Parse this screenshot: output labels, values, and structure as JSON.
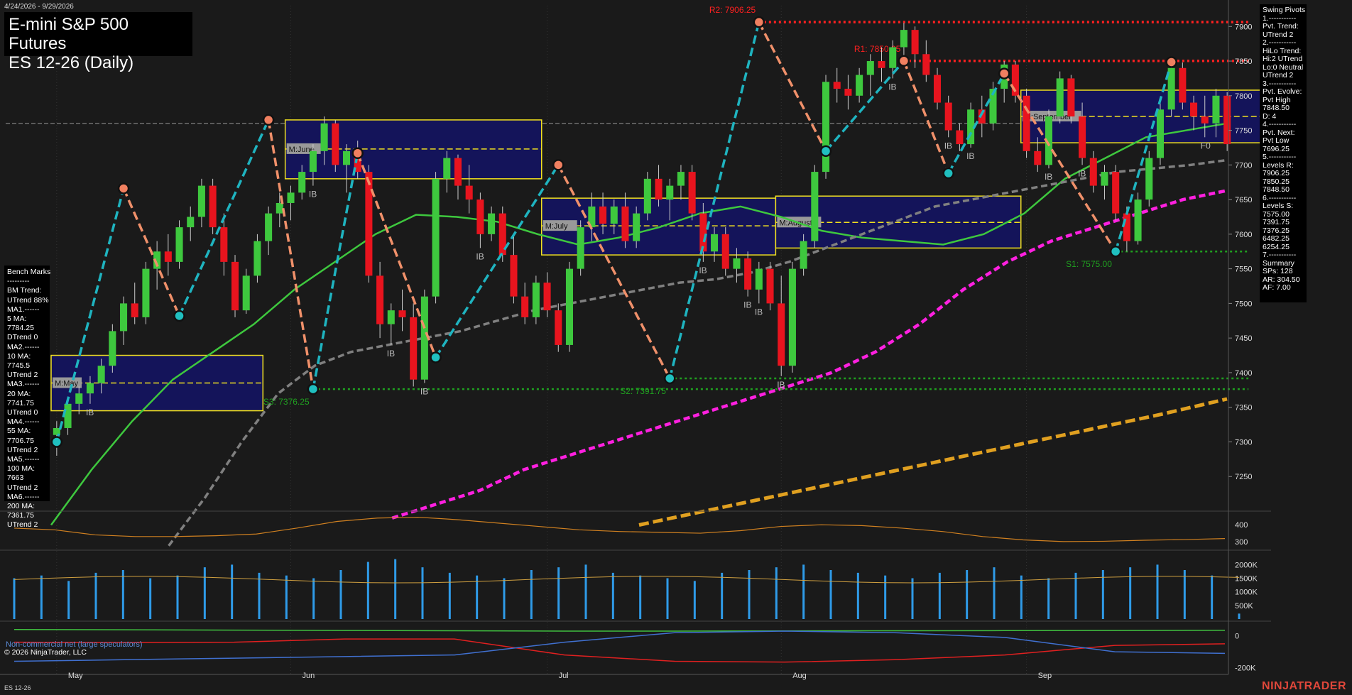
{
  "header": {
    "date_range": "4/24/2026 - 9/29/2026",
    "title": "E-mini S&P 500 Futures",
    "subtitle": "ES 12-26 (Daily)"
  },
  "bench_marks": {
    "lines": [
      "Bench Marks",
      "---------",
      "BM Trend:",
      "UTrend 88%",
      "MA1.------",
      "5 MA:",
      "7784.25",
      "DTrend 0",
      "MA2.------",
      "10 MA:",
      "7745.5",
      "UTrend 2",
      "MA3.------",
      "20 MA:",
      "7741.75",
      "UTrend 0",
      "MA4.------",
      "55 MA:",
      "7706.75",
      "UTrend 2",
      "MA5.------",
      "100 MA:",
      "7663",
      "UTrend 2",
      "MA6.------",
      "200 MA:",
      "7361.75",
      "UTrend 2"
    ]
  },
  "swing_pivots": {
    "lines": [
      "Swing Pivots",
      "1.-----------",
      "Pvt. Trend:",
      "UTrend 2",
      "2.-----------",
      "HiLo Trend:",
      "Hi:2 UTrend",
      "Lo:0 Neutral",
      "UTrend 2",
      "3.-----------",
      "Pvt. Evolve:",
      "Pvt High",
      "7848.50",
      "D: 4",
      "4.-----------",
      "Pvt. Next:",
      "Pvt Low",
      "7696.25",
      "5.-----------",
      "Levels R:",
      "7906.25",
      "7850.25",
      "7848.50",
      "6.-----------",
      "Levels S:",
      "7575.00",
      "7391.75",
      "7376.25",
      "6482.25",
      "6254.25",
      "7.-----------",
      "Summary",
      "SPs: 128",
      "AR: 304.50",
      "AF: 7.00"
    ]
  },
  "footer": {
    "non_commercial": "Non-commercial net (large speculators)",
    "copyright": "© 2026 NinjaTrader, LLC",
    "symbol": "ES 12-26",
    "brand": "NINJATRADER"
  },
  "colors": {
    "background": "#1a1a1a",
    "up_candle": "#3ec83e",
    "down_candle": "#e8141e",
    "zigzag_up": "#1fb4c0",
    "zigzag_down": "#f0906a",
    "ma_green": "#3ec83e",
    "ma_gray": "#808080",
    "ma_magenta": "#ff20e0",
    "ma_gold": "#e0a020",
    "resistance": "#ff2020",
    "support": "#20a020",
    "box_fill": "#14145a",
    "box_border": "#f0e020"
  },
  "chart_data": {
    "type": "candlestick",
    "x_axis": {
      "months": [
        "May",
        "Jun",
        "Jul",
        "Aug",
        "Sep"
      ]
    },
    "price_axis": {
      "ylim": [
        7200,
        7930
      ],
      "ticks": [
        7900,
        7850,
        7800,
        7750,
        7700,
        7650,
        7600,
        7550,
        7500,
        7450,
        7400,
        7350,
        7300,
        7250
      ]
    },
    "panel2_ticks": [
      "400",
      "300"
    ],
    "volume_ticks": [
      "2000K",
      "1500K",
      "1000K",
      "500K"
    ],
    "cot_ticks": [
      "0",
      "-200K"
    ],
    "levels": [
      {
        "label": "R2: 7906.25",
        "value": 7906.25,
        "kind": "resistance"
      },
      {
        "label": "R1: 7850.25",
        "value": 7850.25,
        "kind": "resistance"
      },
      {
        "label": "S1: 7575.00",
        "value": 7575.0,
        "kind": "support"
      },
      {
        "label": "S2: 7391.75",
        "value": 7391.75,
        "kind": "support"
      },
      {
        "label": "S3: 7376.25",
        "value": 7376.25,
        "kind": "support"
      }
    ],
    "monthly_boxes": [
      {
        "label": "M:May",
        "start_bar": 0,
        "end_bar": 18,
        "high": 7425,
        "low": 7345,
        "mid": 7385
      },
      {
        "label": "M:June",
        "start_bar": 21,
        "end_bar": 43,
        "high": 7765,
        "low": 7680,
        "mid": 7723
      },
      {
        "label": "M:July",
        "start_bar": 44,
        "end_bar": 64,
        "high": 7652,
        "low": 7570,
        "mid": 7612
      },
      {
        "label": "M:August",
        "start_bar": 65,
        "end_bar": 86,
        "high": 7655,
        "low": 7580,
        "mid": 7617
      },
      {
        "label": "M:September",
        "start_bar": 87,
        "end_bar": 108,
        "high": 7808,
        "low": 7732,
        "mid": 7770
      }
    ],
    "ib_labels": [
      {
        "text": "IB",
        "bar": 3
      },
      {
        "text": "IB",
        "bar": 23
      },
      {
        "text": "IB",
        "bar": 30
      },
      {
        "text": "IB",
        "bar": 33
      },
      {
        "text": "IB",
        "bar": 38
      },
      {
        "text": "IB",
        "bar": 58
      },
      {
        "text": "IB",
        "bar": 62
      },
      {
        "text": "IB",
        "bar": 63
      },
      {
        "text": "IB",
        "bar": 65
      },
      {
        "text": "IB",
        "bar": 75
      },
      {
        "text": "IB",
        "bar": 80
      },
      {
        "text": "IB",
        "bar": 82
      },
      {
        "text": "IB",
        "bar": 89
      },
      {
        "text": "IB",
        "bar": 92
      },
      {
        "text": "F0",
        "bar": 103
      }
    ],
    "candles": [
      [
        7310,
        7330,
        7280,
        7320
      ],
      [
        7320,
        7365,
        7310,
        7355
      ],
      [
        7355,
        7380,
        7340,
        7370
      ],
      [
        7370,
        7395,
        7355,
        7385
      ],
      [
        7385,
        7420,
        7370,
        7410
      ],
      [
        7410,
        7470,
        7400,
        7460
      ],
      [
        7460,
        7510,
        7440,
        7500
      ],
      [
        7500,
        7530,
        7470,
        7480
      ],
      [
        7480,
        7560,
        7470,
        7550
      ],
      [
        7550,
        7590,
        7520,
        7575
      ],
      [
        7575,
        7600,
        7540,
        7560
      ],
      [
        7560,
        7620,
        7550,
        7610
      ],
      [
        7610,
        7640,
        7590,
        7625
      ],
      [
        7625,
        7680,
        7610,
        7670
      ],
      [
        7670,
        7680,
        7600,
        7610
      ],
      [
        7610,
        7630,
        7540,
        7560
      ],
      [
        7560,
        7570,
        7480,
        7490
      ],
      [
        7490,
        7550,
        7485,
        7540
      ],
      [
        7540,
        7600,
        7530,
        7590
      ],
      [
        7590,
        7640,
        7570,
        7630
      ],
      [
        7630,
        7660,
        7610,
        7645
      ],
      [
        7645,
        7670,
        7620,
        7660
      ],
      [
        7660,
        7700,
        7650,
        7690
      ],
      [
        7690,
        7730,
        7670,
        7720
      ],
      [
        7720,
        7770,
        7700,
        7760
      ],
      [
        7760,
        7765,
        7690,
        7700
      ],
      [
        7700,
        7730,
        7660,
        7720
      ],
      [
        7720,
        7735,
        7680,
        7690
      ],
      [
        7690,
        7700,
        7530,
        7540
      ],
      [
        7540,
        7560,
        7450,
        7470
      ],
      [
        7470,
        7500,
        7440,
        7490
      ],
      [
        7490,
        7520,
        7460,
        7480
      ],
      [
        7480,
        7500,
        7380,
        7390
      ],
      [
        7390,
        7520,
        7385,
        7510
      ],
      [
        7510,
        7690,
        7500,
        7680
      ],
      [
        7680,
        7720,
        7660,
        7710
      ],
      [
        7710,
        7715,
        7650,
        7670
      ],
      [
        7670,
        7700,
        7630,
        7650
      ],
      [
        7650,
        7660,
        7580,
        7600
      ],
      [
        7600,
        7640,
        7590,
        7630
      ],
      [
        7630,
        7640,
        7560,
        7570
      ],
      [
        7570,
        7600,
        7500,
        7510
      ],
      [
        7510,
        7530,
        7470,
        7480
      ],
      [
        7480,
        7540,
        7470,
        7530
      ],
      [
        7530,
        7545,
        7480,
        7490
      ],
      [
        7490,
        7500,
        7430,
        7440
      ],
      [
        7440,
        7560,
        7430,
        7550
      ],
      [
        7550,
        7620,
        7540,
        7610
      ],
      [
        7610,
        7660,
        7590,
        7640
      ],
      [
        7640,
        7660,
        7600,
        7615
      ],
      [
        7615,
        7650,
        7600,
        7640
      ],
      [
        7640,
        7660,
        7580,
        7590
      ],
      [
        7590,
        7640,
        7580,
        7630
      ],
      [
        7630,
        7690,
        7620,
        7680
      ],
      [
        7680,
        7700,
        7640,
        7650
      ],
      [
        7650,
        7680,
        7620,
        7670
      ],
      [
        7670,
        7700,
        7650,
        7690
      ],
      [
        7690,
        7700,
        7620,
        7630
      ],
      [
        7630,
        7645,
        7560,
        7575
      ],
      [
        7575,
        7610,
        7560,
        7600
      ],
      [
        7600,
        7610,
        7540,
        7550
      ],
      [
        7550,
        7580,
        7530,
        7565
      ],
      [
        7565,
        7575,
        7510,
        7520
      ],
      [
        7520,
        7560,
        7500,
        7550
      ],
      [
        7550,
        7560,
        7490,
        7500
      ],
      [
        7500,
        7540,
        7395,
        7410
      ],
      [
        7410,
        7560,
        7400,
        7550
      ],
      [
        7550,
        7600,
        7540,
        7590
      ],
      [
        7590,
        7700,
        7580,
        7690
      ],
      [
        7690,
        7830,
        7680,
        7820
      ],
      [
        7820,
        7840,
        7790,
        7810
      ],
      [
        7810,
        7830,
        7780,
        7800
      ],
      [
        7800,
        7840,
        7790,
        7830
      ],
      [
        7830,
        7860,
        7800,
        7850
      ],
      [
        7850,
        7870,
        7820,
        7840
      ],
      [
        7840,
        7880,
        7825,
        7870
      ],
      [
        7870,
        7905,
        7850,
        7895
      ],
      [
        7895,
        7900,
        7840,
        7860
      ],
      [
        7860,
        7880,
        7820,
        7830
      ],
      [
        7830,
        7840,
        7780,
        7790
      ],
      [
        7790,
        7800,
        7740,
        7750
      ],
      [
        7750,
        7760,
        7720,
        7730
      ],
      [
        7730,
        7790,
        7725,
        7780
      ],
      [
        7780,
        7800,
        7740,
        7760
      ],
      [
        7760,
        7820,
        7750,
        7810
      ],
      [
        7810,
        7850,
        7790,
        7845
      ],
      [
        7845,
        7850,
        7790,
        7800
      ],
      [
        7800,
        7810,
        7710,
        7720
      ],
      [
        7720,
        7740,
        7690,
        7700
      ],
      [
        7700,
        7780,
        7695,
        7770
      ],
      [
        7770,
        7835,
        7760,
        7825
      ],
      [
        7825,
        7830,
        7760,
        7770
      ],
      [
        7770,
        7790,
        7700,
        7710
      ],
      [
        7710,
        7720,
        7660,
        7670
      ],
      [
        7670,
        7700,
        7650,
        7690
      ],
      [
        7690,
        7700,
        7620,
        7630
      ],
      [
        7630,
        7640,
        7575,
        7590
      ],
      [
        7590,
        7660,
        7585,
        7650
      ],
      [
        7650,
        7720,
        7640,
        7710
      ],
      [
        7710,
        7790,
        7700,
        7780
      ],
      [
        7780,
        7845,
        7770,
        7840
      ],
      [
        7840,
        7848,
        7780,
        7790
      ],
      [
        7790,
        7800,
        7750,
        7770
      ],
      [
        7770,
        7800,
        7740,
        7760
      ],
      [
        7760,
        7810,
        7740,
        7800
      ],
      [
        7800,
        7805,
        7720,
        7730
      ]
    ],
    "pivots": [
      {
        "bar": 0,
        "value": 7300,
        "type": "low"
      },
      {
        "bar": 6,
        "value": 7666,
        "type": "high"
      },
      {
        "bar": 11,
        "value": 7482,
        "type": "low"
      },
      {
        "bar": 19,
        "value": 7765,
        "type": "high"
      },
      {
        "bar": 23,
        "value": 7376.25,
        "type": "low"
      },
      {
        "bar": 27,
        "value": 7717,
        "type": "high"
      },
      {
        "bar": 34,
        "value": 7422,
        "type": "low"
      },
      {
        "bar": 45,
        "value": 7700,
        "type": "high"
      },
      {
        "bar": 55,
        "value": 7391.75,
        "type": "low"
      },
      {
        "bar": 63,
        "value": 7906.25,
        "type": "high"
      },
      {
        "bar": 69,
        "value": 7720,
        "type": "low"
      },
      {
        "bar": 76,
        "value": 7850.25,
        "type": "high"
      },
      {
        "bar": 80,
        "value": 7688,
        "type": "low"
      },
      {
        "bar": 85,
        "value": 7832,
        "type": "high"
      },
      {
        "bar": 95,
        "value": 7575,
        "type": "low"
      },
      {
        "bar": 100,
        "value": 7848.5,
        "type": "high"
      }
    ],
    "ma_series": {
      "green_20": [
        7180,
        7260,
        7330,
        7390,
        7430,
        7470,
        7520,
        7560,
        7600,
        7628,
        7625,
        7618,
        7600,
        7585,
        7595,
        7610,
        7630,
        7640,
        7625,
        7605,
        7595,
        7590,
        7585,
        7600,
        7630,
        7680,
        7710,
        7740,
        7750,
        7760
      ],
      "gray_55": [
        7150,
        7220,
        7300,
        7370,
        7410,
        7430,
        7440,
        7450,
        7460,
        7475,
        7490,
        7500,
        7510,
        7520,
        7530,
        7535,
        7545,
        7560,
        7580,
        7600,
        7620,
        7640,
        7650,
        7660,
        7670,
        7680,
        7690,
        7695,
        7700,
        7707
      ],
      "magenta_100": [
        7190,
        7210,
        7230,
        7260,
        7280,
        7300,
        7320,
        7340,
        7360,
        7380,
        7400,
        7430,
        7470,
        7520,
        7560,
        7590,
        7610,
        7630,
        7650,
        7663
      ],
      "gold_200": [
        7180,
        7200,
        7220,
        7240,
        7260,
        7280,
        7300,
        7320,
        7340,
        7362
      ]
    },
    "panel2_values": [
      380,
      370,
      340,
      330,
      330,
      335,
      345,
      380,
      420,
      440,
      445,
      430,
      410,
      390,
      370,
      360,
      355,
      350,
      365,
      390,
      400,
      395,
      380,
      360,
      330,
      310,
      300,
      302,
      308,
      312,
      318
    ],
    "volume_values": [
      1500,
      1600,
      1400,
      1700,
      1800,
      1500,
      1600,
      1900,
      2000,
      1700,
      1600,
      1500,
      1800,
      2100,
      2200,
      1900,
      1700,
      1600,
      1500,
      1800,
      1900,
      2000,
      1700,
      1600,
      1500,
      1400,
      1700,
      1800,
      1900,
      2000,
      1800,
      1700,
      1600,
      1500,
      1700,
      1800,
      1900,
      1600,
      1500,
      1700,
      1800,
      1900,
      2000,
      1800,
      1600,
      200
    ],
    "cot_series": {
      "green": [
        40,
        38,
        36,
        34,
        32,
        30,
        30,
        31,
        32,
        33,
        34,
        35
      ],
      "red": [
        -40,
        -42,
        -40,
        -20,
        -20,
        -120,
        -160,
        -165,
        -150,
        -120,
        -60,
        -50
      ],
      "blue": [
        -160,
        -150,
        -140,
        -130,
        -120,
        -40,
        20,
        30,
        20,
        -10,
        -100,
        -110
      ]
    }
  }
}
